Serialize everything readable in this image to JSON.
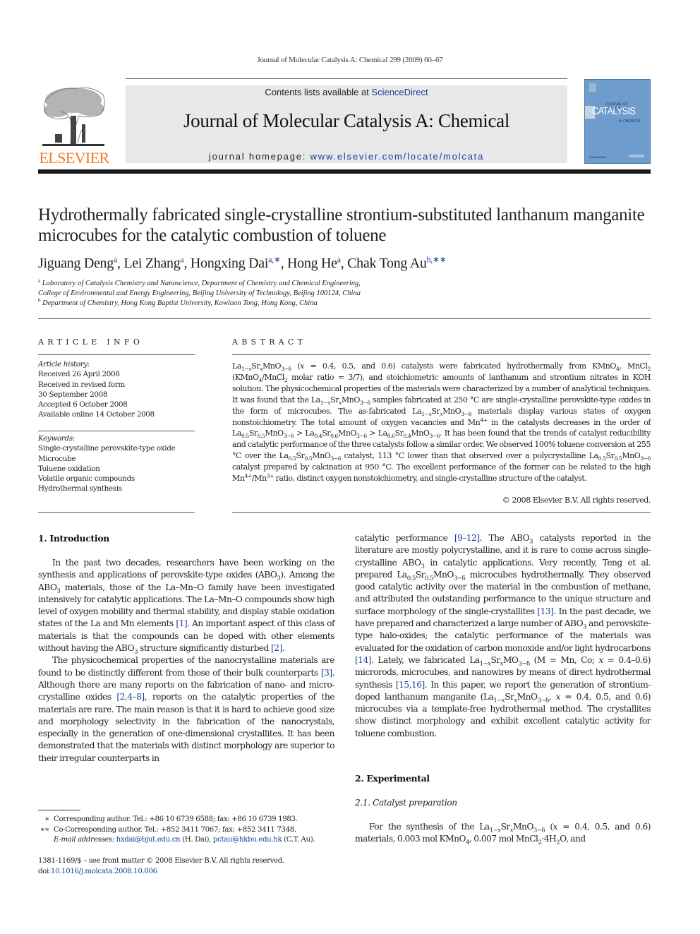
{
  "running_head": "Journal of Molecular Catalysis A: Chemical 299 (2009) 60–67",
  "header": {
    "publisher_logo_text": "ELSEVIER",
    "contents_prefix": "Contents lists available at ",
    "contents_link": "ScienceDirect",
    "journal_title": "Journal of Molecular Catalysis A: Chemical",
    "homepage_prefix": "journal homepage: ",
    "homepage_link": "www.elsevier.com/locate/molcata",
    "cover": {
      "top_text": "JOURNAL OF MOLECULAR",
      "main_word": "CATALYSIS",
      "sub_text": "A: CHEMICAL",
      "color": "#6e9ccc"
    },
    "accent_color": "#f47920",
    "link_color": "#1a3d99"
  },
  "article": {
    "title": "Hydrothermally fabricated single-crystalline strontium-substituted lanthanum manganite microcubes for the catalytic combustion of toluene",
    "authors": [
      {
        "name": "Jiguang Deng",
        "marks": "a"
      },
      {
        "name": "Lei Zhang",
        "marks": "a"
      },
      {
        "name": "Hongxing Dai",
        "marks": "a,∗"
      },
      {
        "name": "Hong He",
        "marks": "a"
      },
      {
        "name": "Chak Tong Au",
        "marks": "b,∗∗"
      }
    ],
    "affiliations": [
      {
        "mark": "a",
        "lines": [
          "Laboratory of Catalysis Chemistry and Nanoscience, Department of Chemistry and Chemical Engineering,",
          "College of Environmental and Energy Engineering, Beijing University of Technology, Beijing 100124, China"
        ]
      },
      {
        "mark": "b",
        "lines": [
          "Department of Chemistry, Hong Kong Baptist University, Kowloon Tong, Hong Kong, China"
        ]
      }
    ]
  },
  "article_info": {
    "heading": "ARTICLE INFO",
    "history_label": "Article history:",
    "history": [
      "Received 26 April 2008",
      "Received in revised form",
      "30 September 2008",
      "Accepted 6 October 2008",
      "Available online 14 October 2008"
    ],
    "keywords_label": "Keywords:",
    "keywords": [
      "Single-crystalline perovskite-type oxide",
      "Microcube",
      "Toluene oxidation",
      "Volatile organic compounds",
      "Hydrothermal synthesis"
    ]
  },
  "abstract": {
    "heading": "ABSTRACT",
    "copyright": "© 2008 Elsevier B.V. All rights reserved."
  },
  "sections": {
    "intro_heading": "1.  Introduction",
    "experimental_heading": "2.  Experimental",
    "catalyst_prep_heading": "2.1.  Catalyst preparation"
  },
  "references": {
    "r1": "[1]",
    "r2": "[2]",
    "r3": "[3]",
    "r2_4_8": "[2,4–8]",
    "r9_12": "[9–12]",
    "r13": "[13]",
    "r14": "[14]",
    "r15_16": "[15,16]"
  },
  "footnotes": {
    "corr1_mark": "∗",
    "corr1": "Corresponding author. Tel.: +86 10 6739 6588; fax: +86 10 6739 1983.",
    "corr2_mark": "∗∗",
    "corr2": "Co-Corresponding author. Tel.: +852 3411 7067; fax: +852 3411 7348.",
    "email_label": "E-mail addresses:",
    "email1": "hxdai@bjut.edu.cn",
    "email1_owner": " (H. Dai), ",
    "email2": "pctau@hkbu.edu.hk",
    "email2_owner": " (C.T. Au).",
    "issn_line": "1381-1169/$ – see front matter © 2008 Elsevier B.V. All rights reserved.",
    "doi_prefix": "doi:",
    "doi": "10.1016/j.molcata.2008.10.006"
  }
}
